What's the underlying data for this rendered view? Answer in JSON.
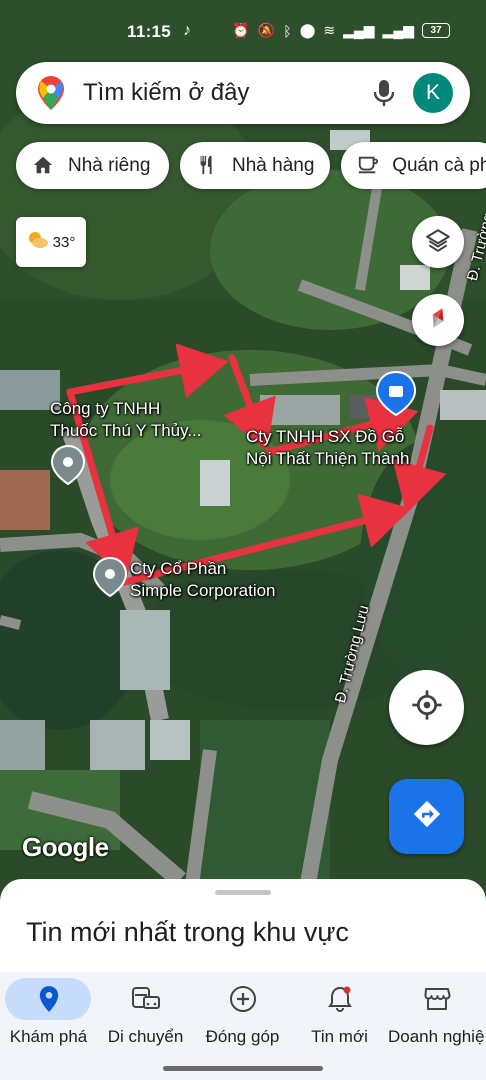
{
  "status_bar": {
    "time": "11:15",
    "app_icon": "tiktok-icon",
    "battery": "37"
  },
  "search": {
    "placeholder": "Tìm kiếm ở đây",
    "avatar_letter": "K"
  },
  "chips": [
    {
      "label": "Nhà riêng",
      "icon": "home-icon"
    },
    {
      "label": "Nhà hàng",
      "icon": "restaurant-icon"
    },
    {
      "label": "Quán cà phê",
      "icon": "cafe-icon"
    }
  ],
  "weather": {
    "temperature": "33°",
    "icon": "partly-cloudy-icon"
  },
  "map": {
    "places": [
      {
        "name_line1": "Công ty TNHH",
        "name_line2": "Thuốc Thú Y Thủy..."
      },
      {
        "name_line1": "Cty TNHH SX Đồ Gỗ",
        "name_line2": "Nội Thất Thiện Thành"
      },
      {
        "name_line1": "Cty Cổ Phần",
        "name_line2": "Simple Corporation"
      }
    ],
    "roads": [
      "Đ. Trường Lưu",
      "Đ. Trường"
    ],
    "attribution": "Google"
  },
  "bottom_sheet": {
    "title": "Tin mới nhất trong khu vực"
  },
  "bottom_nav": [
    {
      "label": "Khám phá",
      "icon": "explore-pin-icon",
      "active": true
    },
    {
      "label": "Di chuyển",
      "icon": "commute-icon",
      "active": false
    },
    {
      "label": "Đóng góp",
      "icon": "contribute-icon",
      "active": false
    },
    {
      "label": "Tin mới",
      "icon": "updates-bell-icon",
      "active": false
    },
    {
      "label": "Doanh nghiệp",
      "icon": "business-icon",
      "active": false
    }
  ],
  "colors": {
    "accent": "#1a73e8",
    "annotation_arrow": "#e8323f",
    "active_nav_pill": "#c7dcfb"
  }
}
